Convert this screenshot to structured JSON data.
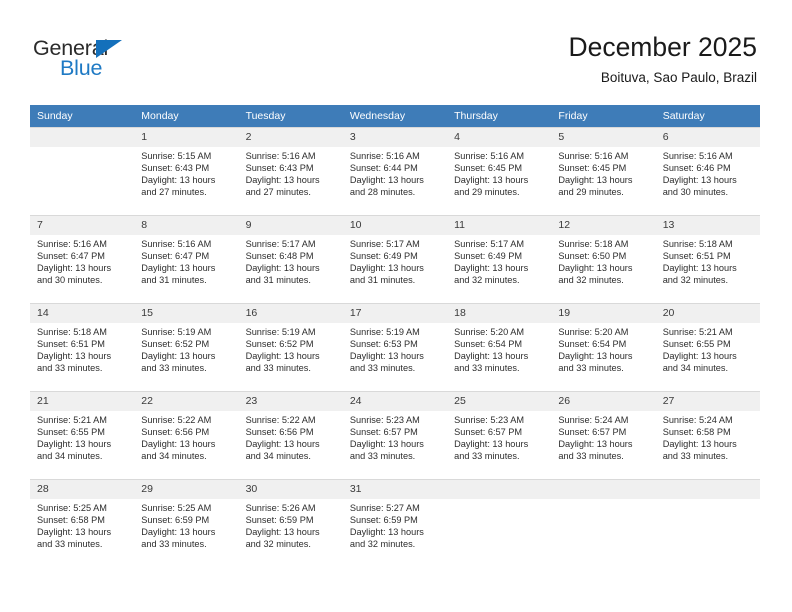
{
  "brand": {
    "name_part1": "General",
    "name_part2": "Blue",
    "triangle_color": "#1470bb",
    "blue_color": "#1f7ac4"
  },
  "header": {
    "title": "December 2025",
    "subtitle": "Boituva, Sao Paulo, Brazil"
  },
  "theme": {
    "header_bg": "#3e7cb8",
    "header_text": "#ffffff",
    "daynum_bg": "#f0f0f0",
    "cell_bg": "#ffffff",
    "border": "#d9d9d9"
  },
  "weekdays": [
    "Sunday",
    "Monday",
    "Tuesday",
    "Wednesday",
    "Thursday",
    "Friday",
    "Saturday"
  ],
  "labels": {
    "sunrise_prefix": "Sunrise:",
    "sunset_prefix": "Sunset:",
    "daylight_prefix": "Daylight:"
  },
  "weeks": [
    [
      {
        "day": "",
        "sunrise": "",
        "sunset": "",
        "daylight_line1": "",
        "daylight_line2": ""
      },
      {
        "day": "1",
        "sunrise": "Sunrise: 5:15 AM",
        "sunset": "Sunset: 6:43 PM",
        "daylight_line1": "Daylight: 13 hours",
        "daylight_line2": "and 27 minutes."
      },
      {
        "day": "2",
        "sunrise": "Sunrise: 5:16 AM",
        "sunset": "Sunset: 6:43 PM",
        "daylight_line1": "Daylight: 13 hours",
        "daylight_line2": "and 27 minutes."
      },
      {
        "day": "3",
        "sunrise": "Sunrise: 5:16 AM",
        "sunset": "Sunset: 6:44 PM",
        "daylight_line1": "Daylight: 13 hours",
        "daylight_line2": "and 28 minutes."
      },
      {
        "day": "4",
        "sunrise": "Sunrise: 5:16 AM",
        "sunset": "Sunset: 6:45 PM",
        "daylight_line1": "Daylight: 13 hours",
        "daylight_line2": "and 29 minutes."
      },
      {
        "day": "5",
        "sunrise": "Sunrise: 5:16 AM",
        "sunset": "Sunset: 6:45 PM",
        "daylight_line1": "Daylight: 13 hours",
        "daylight_line2": "and 29 minutes."
      },
      {
        "day": "6",
        "sunrise": "Sunrise: 5:16 AM",
        "sunset": "Sunset: 6:46 PM",
        "daylight_line1": "Daylight: 13 hours",
        "daylight_line2": "and 30 minutes."
      }
    ],
    [
      {
        "day": "7",
        "sunrise": "Sunrise: 5:16 AM",
        "sunset": "Sunset: 6:47 PM",
        "daylight_line1": "Daylight: 13 hours",
        "daylight_line2": "and 30 minutes."
      },
      {
        "day": "8",
        "sunrise": "Sunrise: 5:16 AM",
        "sunset": "Sunset: 6:47 PM",
        "daylight_line1": "Daylight: 13 hours",
        "daylight_line2": "and 31 minutes."
      },
      {
        "day": "9",
        "sunrise": "Sunrise: 5:17 AM",
        "sunset": "Sunset: 6:48 PM",
        "daylight_line1": "Daylight: 13 hours",
        "daylight_line2": "and 31 minutes."
      },
      {
        "day": "10",
        "sunrise": "Sunrise: 5:17 AM",
        "sunset": "Sunset: 6:49 PM",
        "daylight_line1": "Daylight: 13 hours",
        "daylight_line2": "and 31 minutes."
      },
      {
        "day": "11",
        "sunrise": "Sunrise: 5:17 AM",
        "sunset": "Sunset: 6:49 PM",
        "daylight_line1": "Daylight: 13 hours",
        "daylight_line2": "and 32 minutes."
      },
      {
        "day": "12",
        "sunrise": "Sunrise: 5:18 AM",
        "sunset": "Sunset: 6:50 PM",
        "daylight_line1": "Daylight: 13 hours",
        "daylight_line2": "and 32 minutes."
      },
      {
        "day": "13",
        "sunrise": "Sunrise: 5:18 AM",
        "sunset": "Sunset: 6:51 PM",
        "daylight_line1": "Daylight: 13 hours",
        "daylight_line2": "and 32 minutes."
      }
    ],
    [
      {
        "day": "14",
        "sunrise": "Sunrise: 5:18 AM",
        "sunset": "Sunset: 6:51 PM",
        "daylight_line1": "Daylight: 13 hours",
        "daylight_line2": "and 33 minutes."
      },
      {
        "day": "15",
        "sunrise": "Sunrise: 5:19 AM",
        "sunset": "Sunset: 6:52 PM",
        "daylight_line1": "Daylight: 13 hours",
        "daylight_line2": "and 33 minutes."
      },
      {
        "day": "16",
        "sunrise": "Sunrise: 5:19 AM",
        "sunset": "Sunset: 6:52 PM",
        "daylight_line1": "Daylight: 13 hours",
        "daylight_line2": "and 33 minutes."
      },
      {
        "day": "17",
        "sunrise": "Sunrise: 5:19 AM",
        "sunset": "Sunset: 6:53 PM",
        "daylight_line1": "Daylight: 13 hours",
        "daylight_line2": "and 33 minutes."
      },
      {
        "day": "18",
        "sunrise": "Sunrise: 5:20 AM",
        "sunset": "Sunset: 6:54 PM",
        "daylight_line1": "Daylight: 13 hours",
        "daylight_line2": "and 33 minutes."
      },
      {
        "day": "19",
        "sunrise": "Sunrise: 5:20 AM",
        "sunset": "Sunset: 6:54 PM",
        "daylight_line1": "Daylight: 13 hours",
        "daylight_line2": "and 33 minutes."
      },
      {
        "day": "20",
        "sunrise": "Sunrise: 5:21 AM",
        "sunset": "Sunset: 6:55 PM",
        "daylight_line1": "Daylight: 13 hours",
        "daylight_line2": "and 34 minutes."
      }
    ],
    [
      {
        "day": "21",
        "sunrise": "Sunrise: 5:21 AM",
        "sunset": "Sunset: 6:55 PM",
        "daylight_line1": "Daylight: 13 hours",
        "daylight_line2": "and 34 minutes."
      },
      {
        "day": "22",
        "sunrise": "Sunrise: 5:22 AM",
        "sunset": "Sunset: 6:56 PM",
        "daylight_line1": "Daylight: 13 hours",
        "daylight_line2": "and 34 minutes."
      },
      {
        "day": "23",
        "sunrise": "Sunrise: 5:22 AM",
        "sunset": "Sunset: 6:56 PM",
        "daylight_line1": "Daylight: 13 hours",
        "daylight_line2": "and 34 minutes."
      },
      {
        "day": "24",
        "sunrise": "Sunrise: 5:23 AM",
        "sunset": "Sunset: 6:57 PM",
        "daylight_line1": "Daylight: 13 hours",
        "daylight_line2": "and 33 minutes."
      },
      {
        "day": "25",
        "sunrise": "Sunrise: 5:23 AM",
        "sunset": "Sunset: 6:57 PM",
        "daylight_line1": "Daylight: 13 hours",
        "daylight_line2": "and 33 minutes."
      },
      {
        "day": "26",
        "sunrise": "Sunrise: 5:24 AM",
        "sunset": "Sunset: 6:57 PM",
        "daylight_line1": "Daylight: 13 hours",
        "daylight_line2": "and 33 minutes."
      },
      {
        "day": "27",
        "sunrise": "Sunrise: 5:24 AM",
        "sunset": "Sunset: 6:58 PM",
        "daylight_line1": "Daylight: 13 hours",
        "daylight_line2": "and 33 minutes."
      }
    ],
    [
      {
        "day": "28",
        "sunrise": "Sunrise: 5:25 AM",
        "sunset": "Sunset: 6:58 PM",
        "daylight_line1": "Daylight: 13 hours",
        "daylight_line2": "and 33 minutes."
      },
      {
        "day": "29",
        "sunrise": "Sunrise: 5:25 AM",
        "sunset": "Sunset: 6:59 PM",
        "daylight_line1": "Daylight: 13 hours",
        "daylight_line2": "and 33 minutes."
      },
      {
        "day": "30",
        "sunrise": "Sunrise: 5:26 AM",
        "sunset": "Sunset: 6:59 PM",
        "daylight_line1": "Daylight: 13 hours",
        "daylight_line2": "and 32 minutes."
      },
      {
        "day": "31",
        "sunrise": "Sunrise: 5:27 AM",
        "sunset": "Sunset: 6:59 PM",
        "daylight_line1": "Daylight: 13 hours",
        "daylight_line2": "and 32 minutes."
      },
      {
        "day": "",
        "sunrise": "",
        "sunset": "",
        "daylight_line1": "",
        "daylight_line2": ""
      },
      {
        "day": "",
        "sunrise": "",
        "sunset": "",
        "daylight_line1": "",
        "daylight_line2": ""
      },
      {
        "day": "",
        "sunrise": "",
        "sunset": "",
        "daylight_line1": "",
        "daylight_line2": ""
      }
    ]
  ]
}
